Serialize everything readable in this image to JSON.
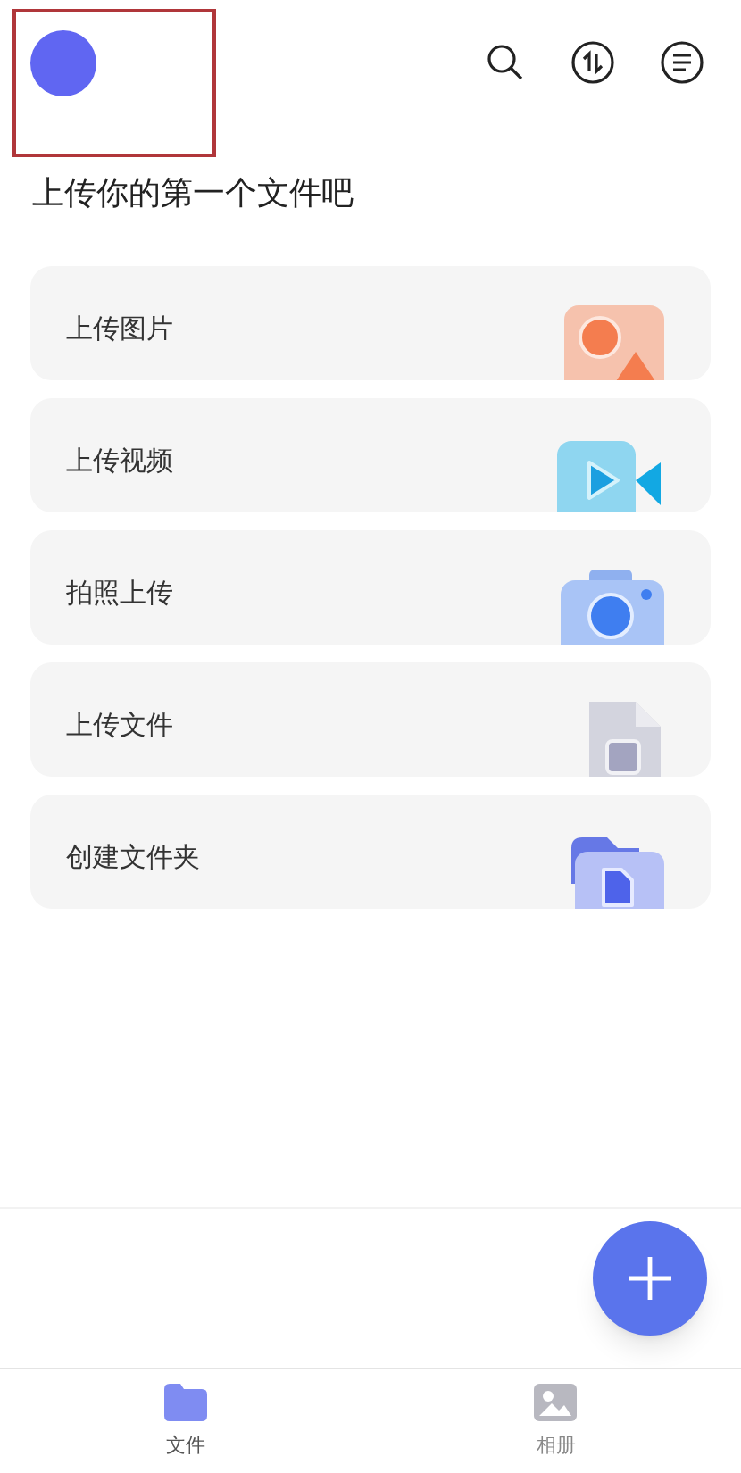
{
  "header": {
    "avatar": {
      "highlighted": true
    }
  },
  "heading": "上传你的第一个文件吧",
  "actions": [
    {
      "label": "上传图片",
      "kind": "image"
    },
    {
      "label": "上传视频",
      "kind": "video"
    },
    {
      "label": "拍照上传",
      "kind": "camera"
    },
    {
      "label": "上传文件",
      "kind": "file"
    },
    {
      "label": "创建文件夹",
      "kind": "folder"
    }
  ],
  "tabs": [
    {
      "label": "文件",
      "kind": "files",
      "selected": true
    },
    {
      "label": "相册",
      "kind": "album",
      "selected": false
    }
  ]
}
